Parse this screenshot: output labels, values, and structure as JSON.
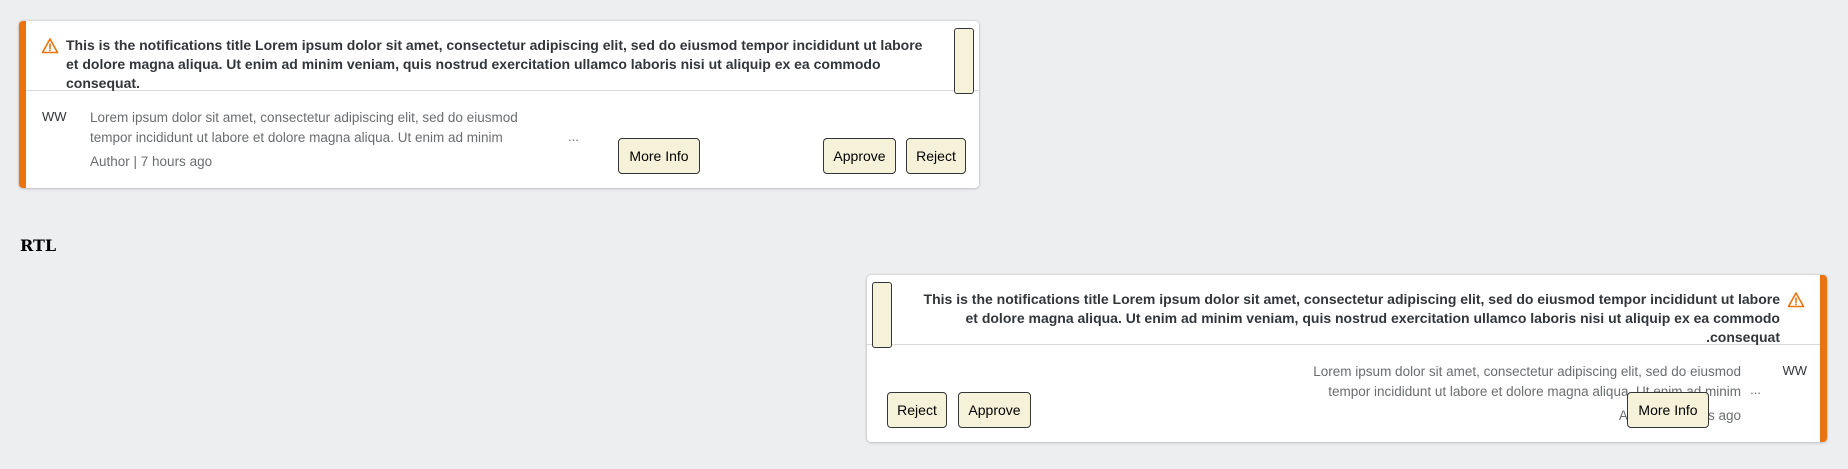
{
  "notification": {
    "title": "This is the notifications title Lorem ipsum dolor sit amet, consectetur adipiscing elit, sed do eiusmod tempor incididunt ut labore et dolore magna aliqua. Ut enim ad minim veniam, quis nostrud exercitation ullamco laboris nisi ut aliquip ex ea commodo consequat.",
    "avatar_initials": "WW",
    "description": "Lorem ipsum dolor sit amet, consectetur adipiscing elit, sed do eiusmod tempor incididunt ut labore et dolore magna aliqua. Ut enim ad minim",
    "ellipsis": "...",
    "meta": "Author | 7 hours ago",
    "more_info_label": "More Info",
    "approve_label": "Approve",
    "reject_label": "Reject",
    "priority_icon": "warning-triangle-icon",
    "accent_color": "#e9730c"
  },
  "rtl_label": "RTL"
}
